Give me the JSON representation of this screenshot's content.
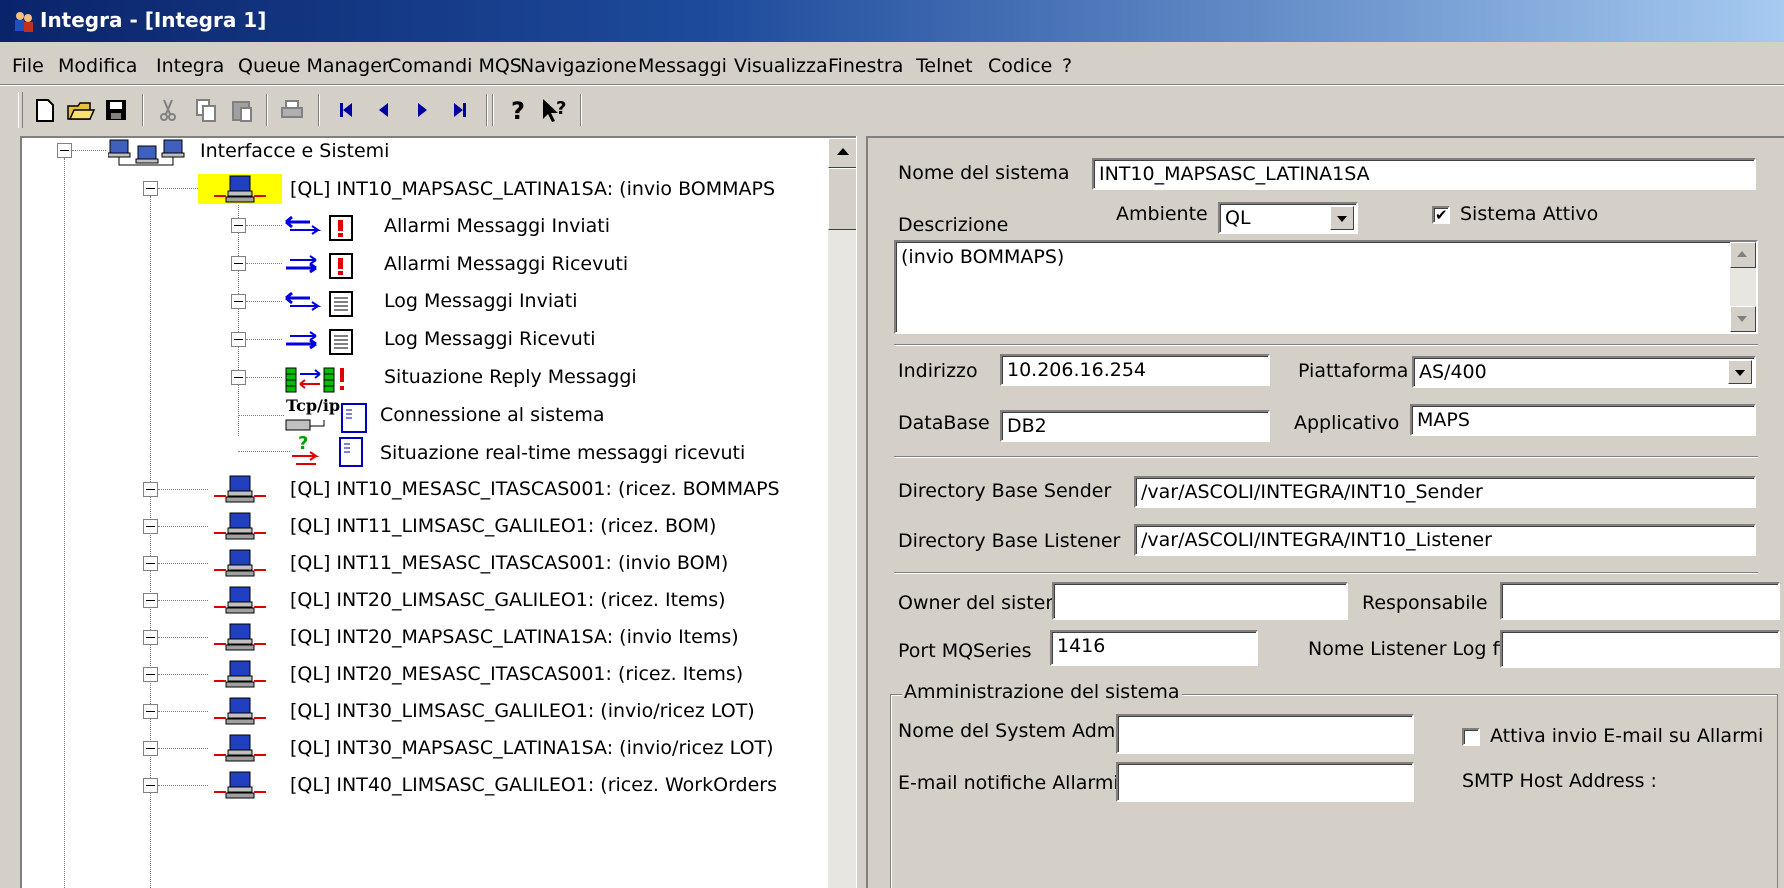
{
  "window": {
    "title": "Integra - [Integra 1]",
    "icon": "app-people-icon"
  },
  "menu": {
    "items": [
      "File",
      "Modifica",
      "Integra",
      "Queue Manager",
      "Comandi MQS",
      "Navigazione",
      "Messaggi",
      "Visualizza",
      "Finestra",
      "Telnet",
      "Codice",
      "?"
    ]
  },
  "toolbar": {
    "buttons": [
      "new-icon",
      "open-icon",
      "save-icon",
      "cut-icon",
      "copy-icon",
      "paste-icon",
      "print-icon",
      "first-icon",
      "prev-icon",
      "next-icon",
      "last-icon",
      "help-icon",
      "context-help-icon"
    ]
  },
  "tree": {
    "root": {
      "label": "Interfacce e Sistemi"
    },
    "expanded_system": {
      "label": "[QL]  INT10_MAPSASC_LATINA1SA: (invio BOMMAPS",
      "children": [
        "Allarmi Messaggi Inviati",
        "Allarmi Messaggi Ricevuti",
        "Log Messaggi Inviati",
        "Log Messaggi Ricevuti",
        "Situazione Reply Messaggi",
        "Connessione al sistema",
        "Situazione real-time messaggi ricevuti"
      ],
      "tcp_label": "Tcp/ip"
    },
    "systems": [
      "[QL]  INT10_MESASC_ITASCAS001: (ricez. BOMMAPS",
      "[QL]  INT11_LIMSASC_GALILEO1: (ricez. BOM)",
      "[QL]  INT11_MESASC_ITASCAS001: (invio BOM)",
      "[QL]  INT20_LIMSASC_GALILEO1: (ricez. Items)",
      "[QL]  INT20_MAPSASC_LATINA1SA: (invio Items)",
      "[QL]  INT20_MESASC_ITASCAS001: (ricez. Items)",
      "[QL]  INT30_LIMSASC_GALILEO1: (invio/ricez LOT)",
      "[QL]  INT30_MAPSASC_LATINA1SA: (invio/ricez LOT)",
      "[QL]  INT40_LIMSASC_GALILEO1: (ricez. WorkOrders"
    ]
  },
  "form": {
    "nome_sistema_label": "Nome del sistema",
    "nome_sistema_value": "INT10_MAPSASC_LATINA1SA",
    "descrizione_label": "Descrizione",
    "ambiente_label": "Ambiente",
    "ambiente_value": "QL",
    "sistema_attivo_label": "Sistema Attivo",
    "sistema_attivo_checked": true,
    "descrizione_value": "(invio BOMMAPS)",
    "indirizzo_label": "Indirizzo",
    "indirizzo_value": "10.206.16.254",
    "piattaforma_label": "Piattaforma",
    "piattaforma_value": "AS/400",
    "database_label": "DataBase",
    "database_value": "DB2",
    "applicativo_label": "Applicativo",
    "applicativo_value": "MAPS",
    "dir_sender_label": "Directory Base Sender",
    "dir_sender_value": "/var/ASCOLI/INTEGRA/INT10_Sender",
    "dir_listener_label": "Directory Base Listener",
    "dir_listener_value": "/var/ASCOLI/INTEGRA/INT10_Listener",
    "owner_label": "Owner del sistema",
    "owner_value": "",
    "responsabile_label": "Responsabile",
    "responsabile_value": "",
    "port_label": "Port MQSeries",
    "port_value": "1416",
    "listener_log_label": "Nome Listener Log file",
    "listener_log_value": "",
    "admin_group_label": "Amministrazione del sistema",
    "sysadmin_label": "Nome del System Admin",
    "sysadmin_value": "",
    "email_alarm_label": "Attiva invio E-mail su Allarmi",
    "email_alarm_checked": false,
    "email_notifiche_label": "E-mail notifiche Allarmi",
    "email_notifiche_value": "",
    "smtp_label": "SMTP Host Address :"
  }
}
